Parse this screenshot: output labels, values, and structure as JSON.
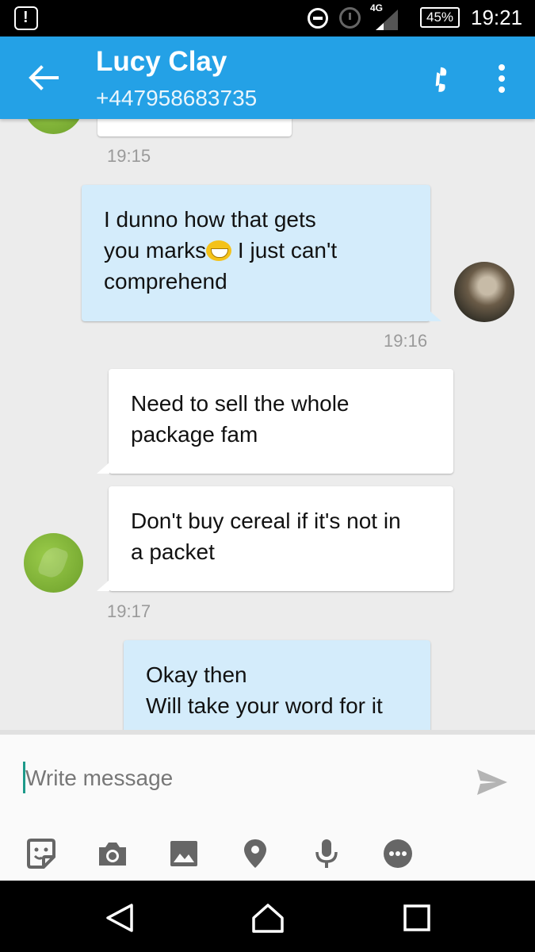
{
  "status_bar": {
    "network": "4G",
    "battery": "45%",
    "time": "19:21"
  },
  "header": {
    "contact_name": "Lucy Clay",
    "contact_number": "+447958683735"
  },
  "messages": [
    {
      "direction": "in",
      "lines": [],
      "time": "19:15"
    },
    {
      "direction": "out",
      "lines": [
        "I dunno how that gets",
        "you marks",
        " I just can't",
        "comprehend"
      ],
      "time": "19:16"
    },
    {
      "direction": "in",
      "lines": [
        "Need to sell the whole",
        "package fam"
      ]
    },
    {
      "direction": "in",
      "lines": [
        "Don't buy cereal if it's not in",
        "a packet"
      ],
      "time": "19:17"
    },
    {
      "direction": "out",
      "lines": [
        "Okay then",
        "Will take your word for it"
      ]
    }
  ],
  "compose": {
    "placeholder": "Write message"
  },
  "icons": {
    "back": "arrow-back-icon",
    "call": "phone-icon",
    "menu": "more-vert-icon",
    "send": "send-icon",
    "tools": [
      "sticker-icon",
      "camera-icon",
      "image-icon",
      "location-icon",
      "microphone-icon",
      "more-icon"
    ]
  },
  "colors": {
    "app_bar": "#24a1e6",
    "incoming_bubble": "#ffffff",
    "outgoing_bubble": "#d4ecfb",
    "background": "#ececec"
  }
}
